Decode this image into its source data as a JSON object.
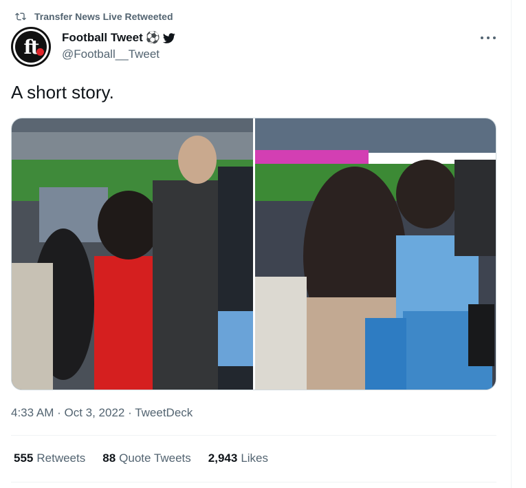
{
  "retweet_banner": {
    "text": "Transfer News Live Retweeted",
    "icon": "retweet-icon"
  },
  "author": {
    "display_name": "Football Tweet",
    "emoji": "⚽",
    "badge_icon": "twitter-bird-icon",
    "handle": "@Football__Tweet",
    "avatar_text": "ft"
  },
  "tweet": {
    "text": "A short story.",
    "timestamp": "4:33 AM · Oct 3, 2022",
    "separator": " · ",
    "source": "TweetDeck"
  },
  "media": {
    "photos": [
      {
        "description": "Stadium crowd with boy in red jersey"
      },
      {
        "description": "Stadium crowd with girl and boy in sky-blue seats"
      }
    ]
  },
  "stats": [
    {
      "count": "555",
      "label": "Retweets"
    },
    {
      "count": "88",
      "label": "Quote Tweets"
    },
    {
      "count": "2,943",
      "label": "Likes"
    }
  ],
  "colors": {
    "text_primary": "#0f1419",
    "text_secondary": "#536471",
    "border": "#eff3f4",
    "twitter_blue": "#1d9bf0"
  }
}
